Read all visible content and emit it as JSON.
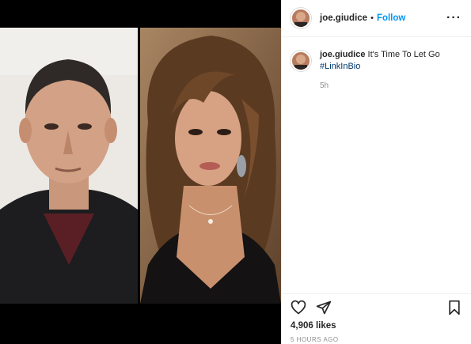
{
  "post": {
    "username": "joe.giudice",
    "separator": "•",
    "follow_label": "Follow",
    "more_label": "···",
    "caption_text": " It's Time To Let Go",
    "caption_hashtag": "#LinkInBio",
    "caption_time": "5h",
    "likes": "4,906 likes",
    "posted_ago": "5 HOURS AGO"
  },
  "icons": {
    "more": "more-options-icon",
    "like": "heart-icon",
    "share": "share-icon",
    "save": "bookmark-icon"
  },
  "colors": {
    "accent": "#0095f6",
    "hashtag": "#00376b",
    "muted": "#8e8e8e",
    "text": "#262626",
    "divider": "#efefef"
  }
}
